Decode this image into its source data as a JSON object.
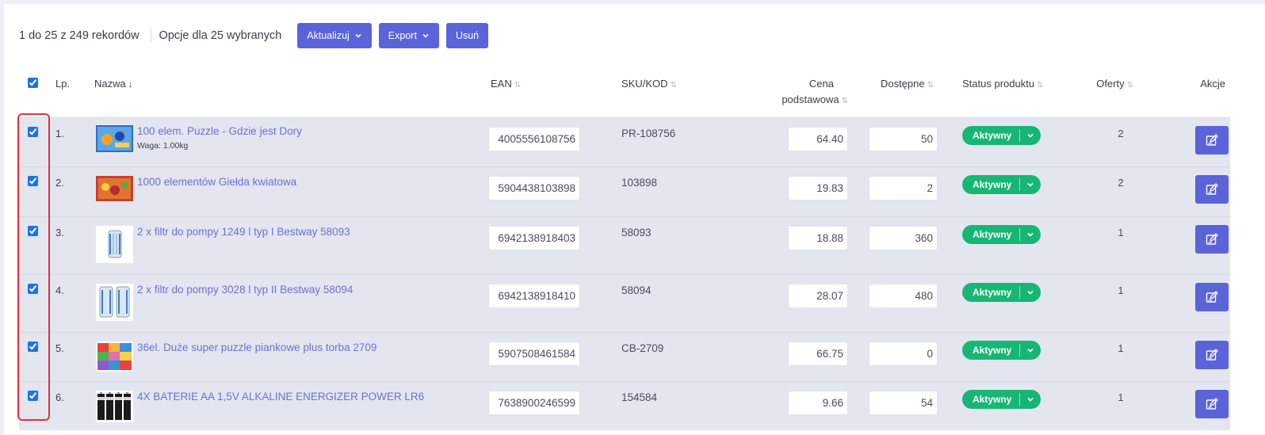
{
  "toolbar": {
    "records": "1 do 25 z 249 rekordów",
    "options": "Opcje dla 25 wybranych",
    "update_label": "Aktualizuj",
    "export_label": "Export",
    "delete_label": "Usuń"
  },
  "columns": {
    "lp": "Lp.",
    "name": "Nazwa",
    "ean": "EAN",
    "sku": "SKU/KOD",
    "price_line1": "Cena",
    "price_line2": "podstawowa",
    "available": "Dostępne",
    "status": "Status produktu",
    "offers": "Oferty",
    "actions": "Akcje"
  },
  "rows": [
    {
      "lp": "1.",
      "name": "100 elem. Puzzle - Gdzie jest Dory",
      "weight": "Waga: 1.00kg",
      "ean": "4005556108756",
      "sku": "PR-108756",
      "price": "64.40",
      "available": "50",
      "status": "Aktywny",
      "offers": "2",
      "thumb": "puzzle-dory-icon"
    },
    {
      "lp": "2.",
      "name": "1000 elementów Giełda kwiatowa",
      "weight": "",
      "ean": "5904438103898",
      "sku": "103898",
      "price": "19.83",
      "available": "2",
      "status": "Aktywny",
      "offers": "2",
      "thumb": "puzzle-flowers-icon"
    },
    {
      "lp": "3.",
      "name": "2 x filtr do pompy 1249 l typ I Bestway 58093",
      "weight": "",
      "ean": "6942138918403",
      "sku": "58093",
      "price": "18.88",
      "available": "360",
      "status": "Aktywny",
      "offers": "1",
      "thumb": "filter-single-icon"
    },
    {
      "lp": "4.",
      "name": "2 x filtr do pompy 3028 l typ II Bestway 58094",
      "weight": "",
      "ean": "6942138918410",
      "sku": "58094",
      "price": "28.07",
      "available": "480",
      "status": "Aktywny",
      "offers": "1",
      "thumb": "filter-double-icon"
    },
    {
      "lp": "5.",
      "name": "36el. Duże super puzzle piankowe plus torba 2709",
      "weight": "",
      "ean": "5907508461584",
      "sku": "CB-2709",
      "price": "66.75",
      "available": "0",
      "status": "Aktywny",
      "offers": "1",
      "thumb": "foam-puzzle-icon"
    },
    {
      "lp": "6.",
      "name": "4X BATERIE AA 1,5V ALKALINE ENERGIZER POWER LR6",
      "weight": "",
      "ean": "7638900246599",
      "sku": "154584",
      "price": "9.66",
      "available": "54",
      "status": "Aktywny",
      "offers": "1",
      "thumb": "batteries-icon"
    }
  ],
  "colors": {
    "accent": "#5b63d9",
    "status_green": "#17b675",
    "link": "#6a71d4",
    "row_bg": "#e3e6ef",
    "highlight": "#e0323a"
  }
}
